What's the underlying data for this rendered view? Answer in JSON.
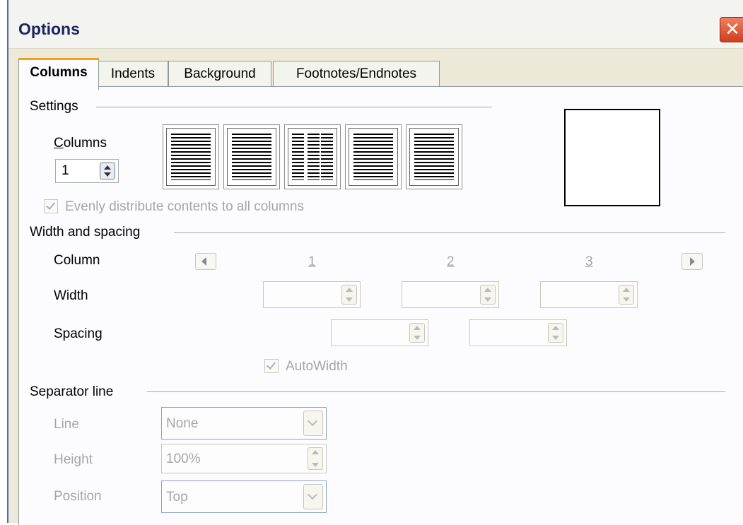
{
  "window": {
    "title": "Options"
  },
  "tabs": [
    "Columns",
    "Indents",
    "Background",
    "Footnotes/Endnotes"
  ],
  "settings": {
    "heading": "Settings",
    "columns_label": "Columns",
    "columns_value": "1",
    "evenly_label": "Evenly distribute contents to all columns"
  },
  "width_spacing": {
    "heading": "Width and spacing",
    "column_label": "Column",
    "width_label": "Width",
    "spacing_label": "Spacing",
    "col_numbers": [
      "1",
      "2",
      "3"
    ],
    "autowidth_label": "AutoWidth"
  },
  "separator": {
    "heading": "Separator line",
    "line_label": "Line",
    "line_value": "None",
    "height_label": "Height",
    "height_value": "100%",
    "position_label": "Position",
    "position_value": "Top"
  },
  "icons": [
    "close-icon",
    "arrow-left-icon",
    "arrow-right-icon",
    "checkmark-icon",
    "spin-arrows-icon",
    "dropdown-arrow-icon"
  ]
}
